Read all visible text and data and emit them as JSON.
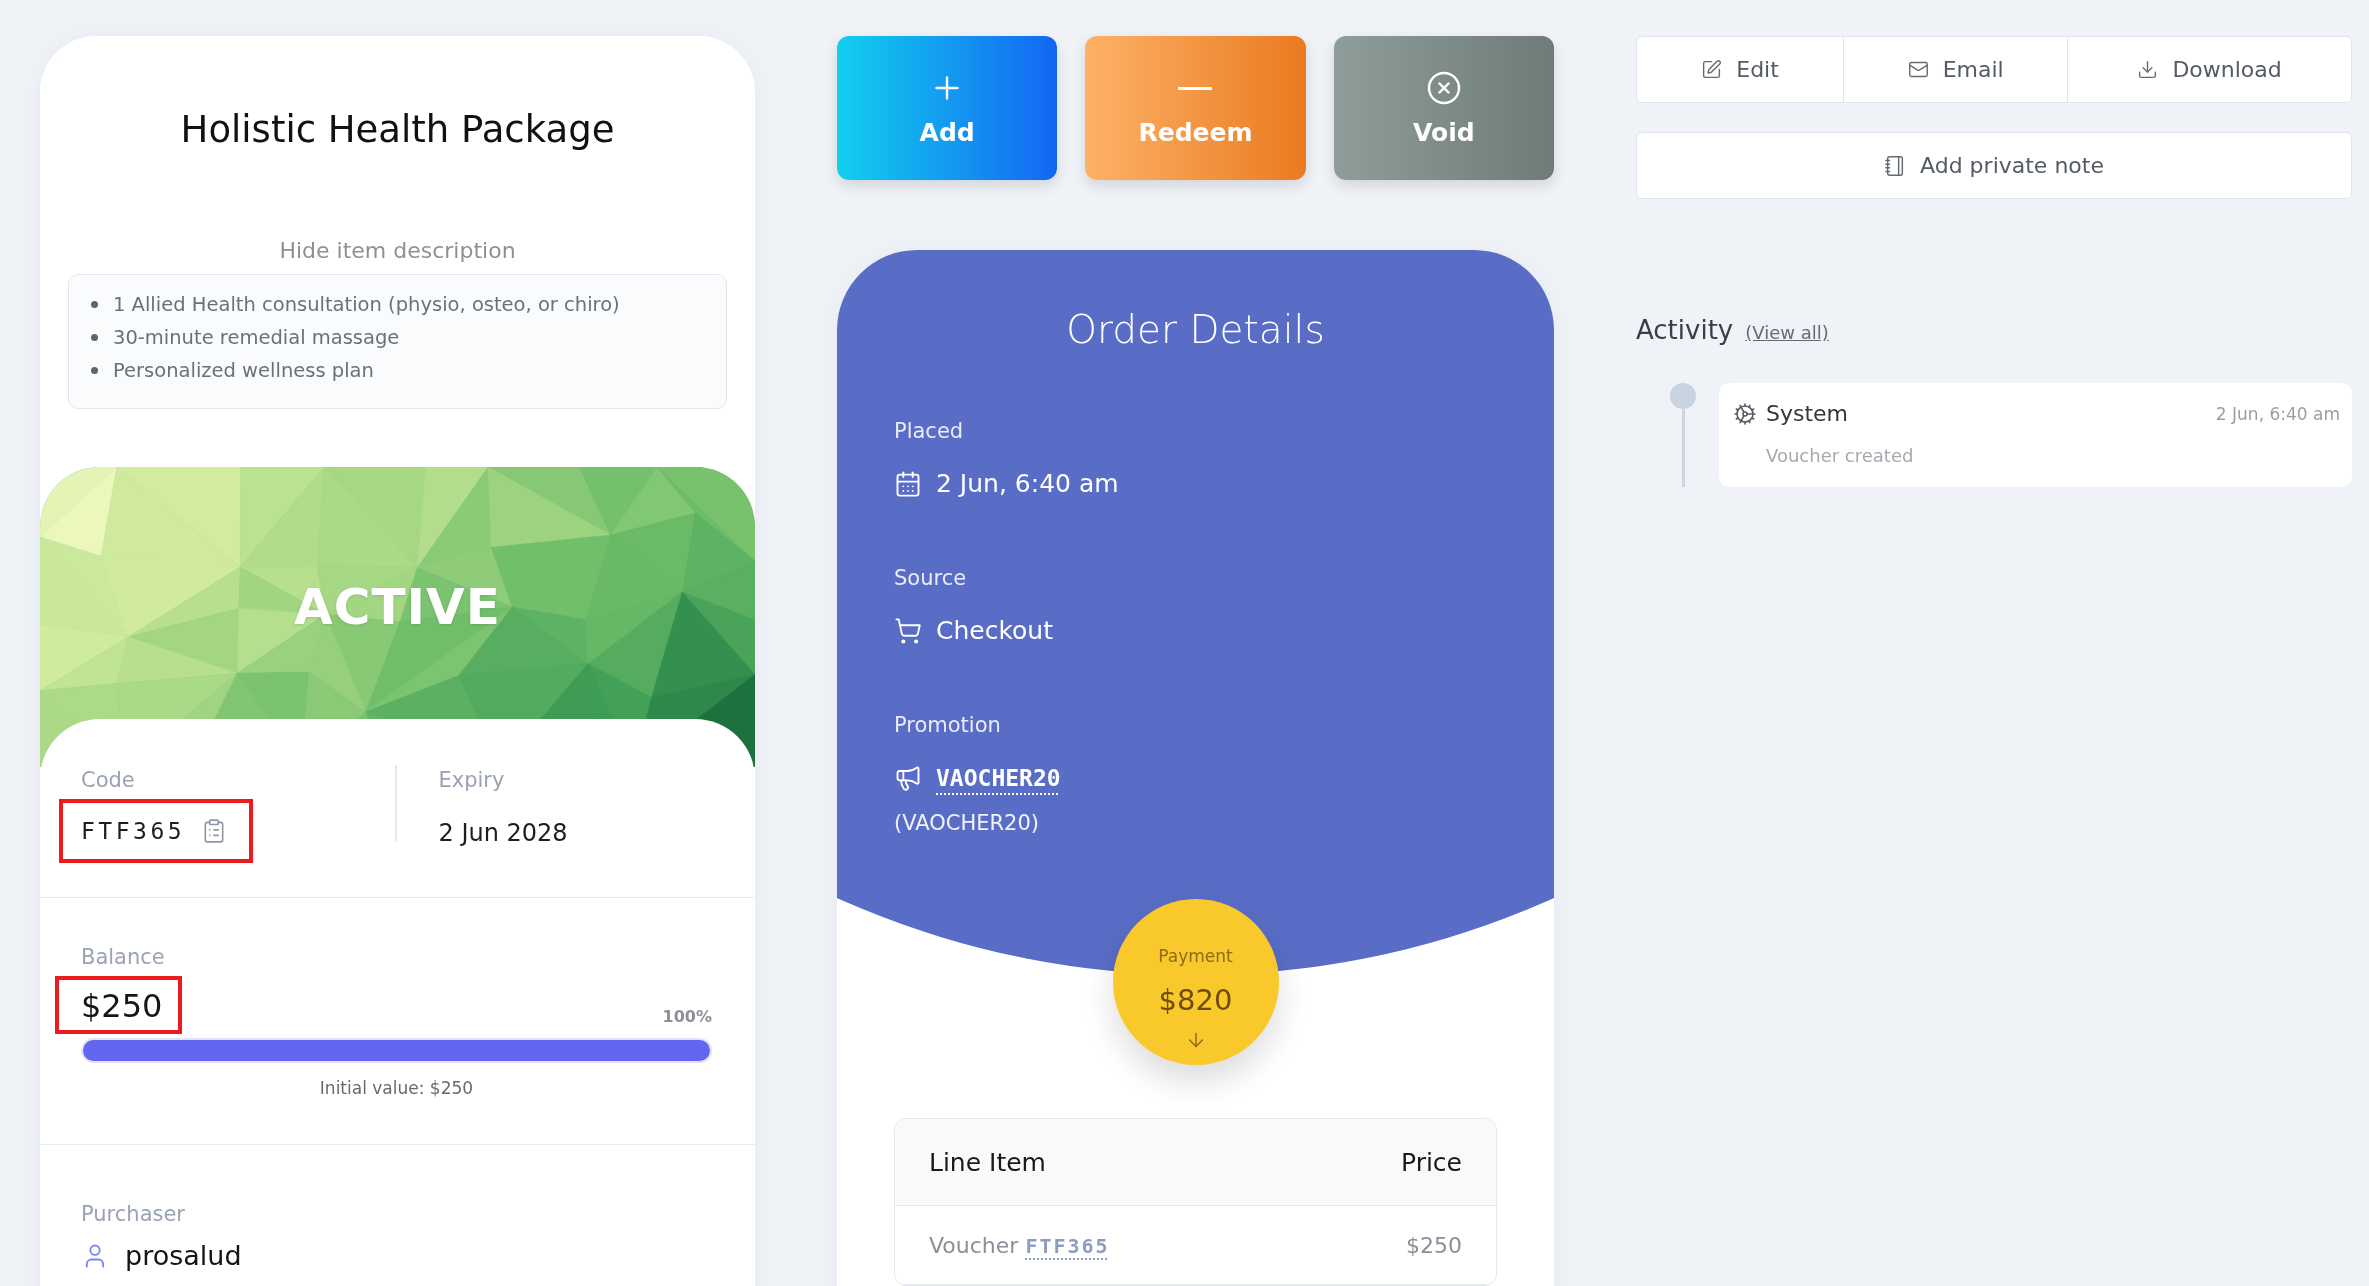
{
  "item": {
    "title": "Holistic Health Package",
    "description_toggle": "Hide item description",
    "description": [
      "1 Allied Health consultation (physio, osteo, or chiro)",
      "30-minute remedial massage",
      "Personalized wellness plan"
    ]
  },
  "status": {
    "label": "ACTIVE",
    "kind": "active"
  },
  "code": {
    "label": "Code",
    "value": "FTF365",
    "highlighted": true
  },
  "expiry": {
    "label": "Expiry",
    "value": "2 Jun 2028"
  },
  "balance": {
    "label": "Balance",
    "value": "$250",
    "highlighted": true,
    "percent": "100%",
    "level": 1,
    "initial": "Initial value: $250"
  },
  "purchaser": {
    "label": "Purchaser",
    "name": "prosalud"
  },
  "actions": [
    {
      "kind": "add",
      "label": "Add"
    },
    {
      "kind": "redeem",
      "label": "Redeem"
    },
    {
      "kind": "void",
      "label": "Void"
    }
  ],
  "order": {
    "title": "Order Details",
    "fields": [
      {
        "kind": "placed",
        "label": "Placed",
        "value": "2 Jun, 6:40 am"
      },
      {
        "kind": "source",
        "label": "Source",
        "value": "Checkout"
      },
      {
        "kind": "promotion",
        "label": "Promotion",
        "value": "VAOCHER20",
        "note": "(VAOCHER20)"
      }
    ],
    "payment": {
      "label": "Payment",
      "amount": "$820"
    },
    "table": {
      "columns": [
        "Line Item",
        "Price"
      ],
      "rows": [
        {
          "item": "Voucher",
          "code": "FTF365",
          "price": "$250"
        }
      ]
    }
  },
  "toolbar": [
    {
      "kind": "edit",
      "label": "Edit"
    },
    {
      "kind": "email",
      "label": "Email"
    },
    {
      "kind": "download",
      "label": "Download"
    }
  ],
  "note_button": {
    "label": "Add private note"
  },
  "activity": {
    "title": "Activity",
    "link": "(View all)",
    "entries": [
      {
        "actor": "System",
        "time": "2 Jun, 6:40 am",
        "text": "Voucher created"
      }
    ]
  }
}
